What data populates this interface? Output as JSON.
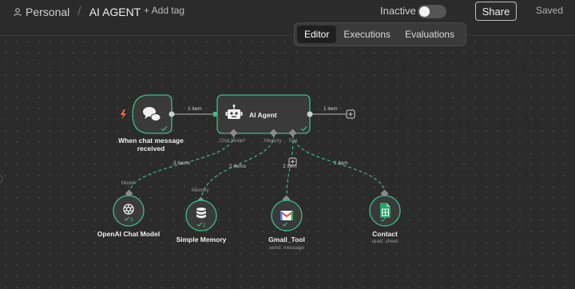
{
  "header": {
    "breadcrumb_workspace": "Personal",
    "breadcrumb_separator": "/",
    "workflow_title": "AI AGENT",
    "add_tag_label": "+ Add tag",
    "status_label": "Inactive",
    "share_label": "Share",
    "saved_label": "Saved"
  },
  "view_tabs": [
    {
      "label": "Editor",
      "active": true
    },
    {
      "label": "Executions",
      "active": false
    },
    {
      "label": "Evaluations",
      "active": false
    }
  ],
  "nodes": {
    "trigger": {
      "label_line1": "When chat message",
      "label_line2": "received",
      "icon": "chat-bubbles-icon"
    },
    "agent": {
      "label": "AI Agent",
      "icon": "robot-icon"
    },
    "chat_model": {
      "label": "OpenAI Chat Model",
      "badge": "3",
      "icon": "openai-icon"
    },
    "memory": {
      "label": "Simple Memory",
      "badge": "2",
      "icon": "database-icon"
    },
    "gmail": {
      "label": "Gmail_Tool",
      "sub": "send: message",
      "icon": "gmail-icon"
    },
    "contact": {
      "label": "Contact",
      "sub": "read: sheet",
      "icon": "sheets-icon"
    }
  },
  "ports": {
    "chat_model": "Chat Model*",
    "memory": "Memory",
    "tool": "Tool",
    "model_input": "Model",
    "memory_input": "Memory"
  },
  "edges": {
    "trigger_to_agent": "1 item",
    "agent_out": "1 item",
    "to_model": "3 items",
    "to_memory": "2 items",
    "to_gmail": "1 item",
    "to_contact": "1 item"
  },
  "colors": {
    "accent_green": "#3dbb8a",
    "node_bg": "#3a3a3a",
    "trigger_bolt": "#ff6a3d"
  }
}
